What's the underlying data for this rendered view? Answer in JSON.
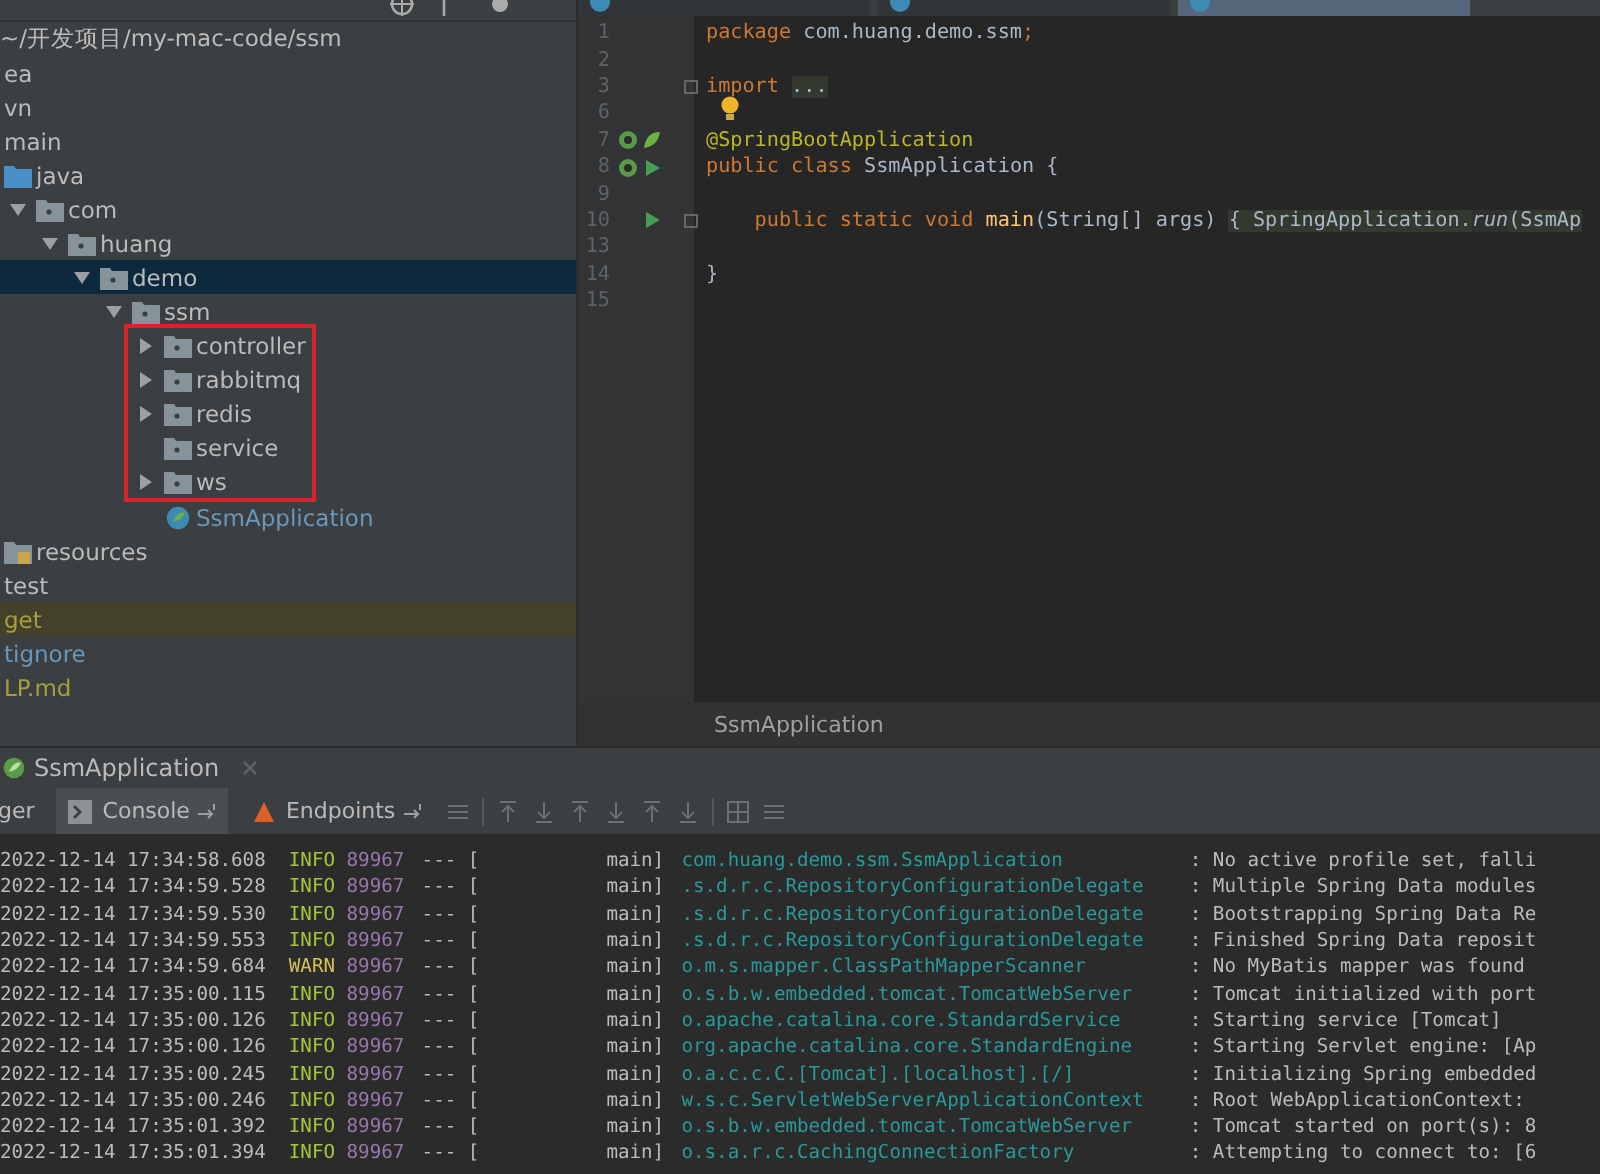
{
  "project_panel": {
    "path": "~/开发项目/my-mac-code/ssm",
    "tree": [
      {
        "label": "ea",
        "highlighted": false
      },
      {
        "label": "vn",
        "highlighted": false
      },
      {
        "label": "main",
        "highlighted": false,
        "children": [
          {
            "label": "java",
            "kind": "source-folder",
            "children": [
              {
                "label": "com",
                "kind": "package",
                "expanded": true,
                "children": [
                  {
                    "label": "huang",
                    "kind": "package",
                    "expanded": true,
                    "children": [
                      {
                        "label": "demo",
                        "kind": "package",
                        "selected": true,
                        "expanded": true,
                        "children": [
                          {
                            "label": "ssm",
                            "kind": "package",
                            "selected": false,
                            "expanded": true,
                            "children": [
                              {
                                "label": "controller",
                                "kind": "package",
                                "expanded": false,
                                "boxed": true
                              },
                              {
                                "label": "rabbitmq",
                                "kind": "package",
                                "expanded": false,
                                "boxed": true
                              },
                              {
                                "label": "redis",
                                "kind": "package",
                                "expanded": false,
                                "boxed": true
                              },
                              {
                                "label": "service",
                                "kind": "package",
                                "boxed": true
                              },
                              {
                                "label": "ws",
                                "kind": "package",
                                "expanded": false,
                                "boxed": true
                              },
                              {
                                "label": "SsmApplication",
                                "kind": "spring-class",
                                "color": "#6897bb",
                                "boxed": false
                              }
                            ]
                          }
                        ]
                      }
                    ]
                  }
                ]
              }
            ]
          },
          {
            "label": "resources",
            "kind": "resource-folder"
          }
        ]
      },
      {
        "label": "test",
        "highlighted": false
      },
      {
        "label": "get",
        "color": "#a59f3e",
        "highlighted": true
      },
      {
        "label": "tignore",
        "color": "#6897bb",
        "highlighted": false
      },
      {
        "label": "LP.md",
        "color": "#a59f3e",
        "highlighted": false
      }
    ]
  },
  "editor": {
    "tabs": [
      {
        "selected": false
      },
      {
        "selected": false
      },
      {
        "selected": true
      }
    ],
    "lines": [
      {
        "number": "1",
        "tokens": [
          {
            "kind": "keyword",
            "text": "package "
          },
          {
            "kind": "plain",
            "text": "com.huang.demo.ssm"
          },
          {
            "kind": "keyword",
            "text": ";"
          }
        ]
      },
      {
        "number": "2"
      },
      {
        "number": "3",
        "fold": true,
        "tokens": [
          {
            "kind": "keyword",
            "text": "import "
          },
          {
            "kind": "fold",
            "text": "..."
          }
        ]
      },
      {
        "number": "6",
        "bulb": true
      },
      {
        "number": "7",
        "gutter": [
          {
            "kind": "spring-bean"
          },
          {
            "kind": "spring-leaf"
          }
        ],
        "tokens": [
          {
            "kind": "annotation",
            "text": "@SpringBootApplication"
          }
        ]
      },
      {
        "number": "8",
        "gutter": [
          {
            "kind": "spring-bean"
          },
          {
            "kind": "run"
          }
        ],
        "tokens": [
          {
            "kind": "keyword",
            "text": "public class "
          },
          {
            "kind": "plain",
            "text": "SsmApplication {"
          }
        ]
      },
      {
        "number": "9"
      },
      {
        "number": "10",
        "gutter": [
          {
            "kind": "blank"
          },
          {
            "kind": "run"
          }
        ],
        "fold": true,
        "tokens": [
          {
            "kind": "keyword",
            "text": "    public static void "
          },
          {
            "kind": "method",
            "text": "main"
          },
          {
            "kind": "plain",
            "text": "(String[] args) "
          },
          {
            "kind": "fold",
            "text": "{ SpringApplication."
          },
          {
            "kind": "static-call",
            "text": "run"
          },
          {
            "kind": "fold",
            "text": "(SsmAp"
          }
        ]
      },
      {
        "number": "13"
      },
      {
        "number": "14",
        "tokens": [
          {
            "kind": "plain",
            "text": "}"
          }
        ]
      },
      {
        "number": "15"
      }
    ],
    "breadcrumb": "SsmApplication"
  },
  "run_panel": {
    "tab": "SsmApplication",
    "tools": [
      {
        "label": "ger",
        "selected": false,
        "kind": "plain"
      },
      {
        "label": "Console",
        "selected": true,
        "kind": "console"
      },
      {
        "label": "Endpoints",
        "selected": false,
        "kind": "endpoints"
      }
    ],
    "log": [
      {
        "time": "2022-12-14 17:34:58.608",
        "kind": "info",
        "level": "INFO",
        "pid": "89967",
        "sep": "---",
        "thread": "[           main]",
        "logger": "com.huang.demo.ssm.SsmApplication",
        "message": ": No active profile set, falli"
      },
      {
        "time": "2022-12-14 17:34:59.528",
        "kind": "info",
        "level": "INFO",
        "pid": "89967",
        "sep": "---",
        "thread": "[           main]",
        "logger": ".s.d.r.c.RepositoryConfigurationDelegate",
        "message": ": Multiple Spring Data modules"
      },
      {
        "time": "2022-12-14 17:34:59.530",
        "kind": "info",
        "level": "INFO",
        "pid": "89967",
        "sep": "---",
        "thread": "[           main]",
        "logger": ".s.d.r.c.RepositoryConfigurationDelegate",
        "message": ": Bootstrapping Spring Data Re"
      },
      {
        "time": "2022-12-14 17:34:59.553",
        "kind": "info",
        "level": "INFO",
        "pid": "89967",
        "sep": "---",
        "thread": "[           main]",
        "logger": ".s.d.r.c.RepositoryConfigurationDelegate",
        "message": ": Finished Spring Data reposit"
      },
      {
        "time": "2022-12-14 17:34:59.684",
        "kind": "warn",
        "level": "WARN",
        "pid": "89967",
        "sep": "---",
        "thread": "[           main]",
        "logger": "o.m.s.mapper.ClassPathMapperScanner",
        "message": ": No MyBatis mapper was found"
      },
      {
        "time": "2022-12-14 17:35:00.115",
        "kind": "info",
        "level": "INFO",
        "pid": "89967",
        "sep": "---",
        "thread": "[           main]",
        "logger": "o.s.b.w.embedded.tomcat.TomcatWebServer",
        "message": ": Tomcat initialized with port"
      },
      {
        "time": "2022-12-14 17:35:00.126",
        "kind": "info",
        "level": "INFO",
        "pid": "89967",
        "sep": "---",
        "thread": "[           main]",
        "logger": "o.apache.catalina.core.StandardService",
        "message": ": Starting service [Tomcat]"
      },
      {
        "time": "2022-12-14 17:35:00.126",
        "kind": "info",
        "level": "INFO",
        "pid": "89967",
        "sep": "---",
        "thread": "[           main]",
        "logger": "org.apache.catalina.core.StandardEngine",
        "message": ": Starting Servlet engine: [Ap"
      },
      {
        "time": "2022-12-14 17:35:00.245",
        "kind": "info",
        "level": "INFO",
        "pid": "89967",
        "sep": "---",
        "thread": "[           main]",
        "logger": "o.a.c.c.C.[Tomcat].[localhost].[/]",
        "message": ": Initializing Spring embedded"
      },
      {
        "time": "2022-12-14 17:35:00.246",
        "kind": "info",
        "level": "INFO",
        "pid": "89967",
        "sep": "---",
        "thread": "[           main]",
        "logger": "w.s.c.ServletWebServerApplicationContext",
        "message": ": Root WebApplicationContext:"
      },
      {
        "time": "2022-12-14 17:35:01.392",
        "kind": "info",
        "level": "INFO",
        "pid": "89967",
        "sep": "---",
        "thread": "[           main]",
        "logger": "o.s.b.w.embedded.tomcat.TomcatWebServer",
        "message": ": Tomcat started on port(s): 8"
      },
      {
        "time": "2022-12-14 17:35:01.394",
        "kind": "info",
        "level": "INFO",
        "pid": "89967",
        "sep": "---",
        "thread": "[           main]",
        "logger": "o.s.a.r.c.CachingConnectionFactory",
        "message": ": Attempting to connect to: [6"
      }
    ]
  }
}
